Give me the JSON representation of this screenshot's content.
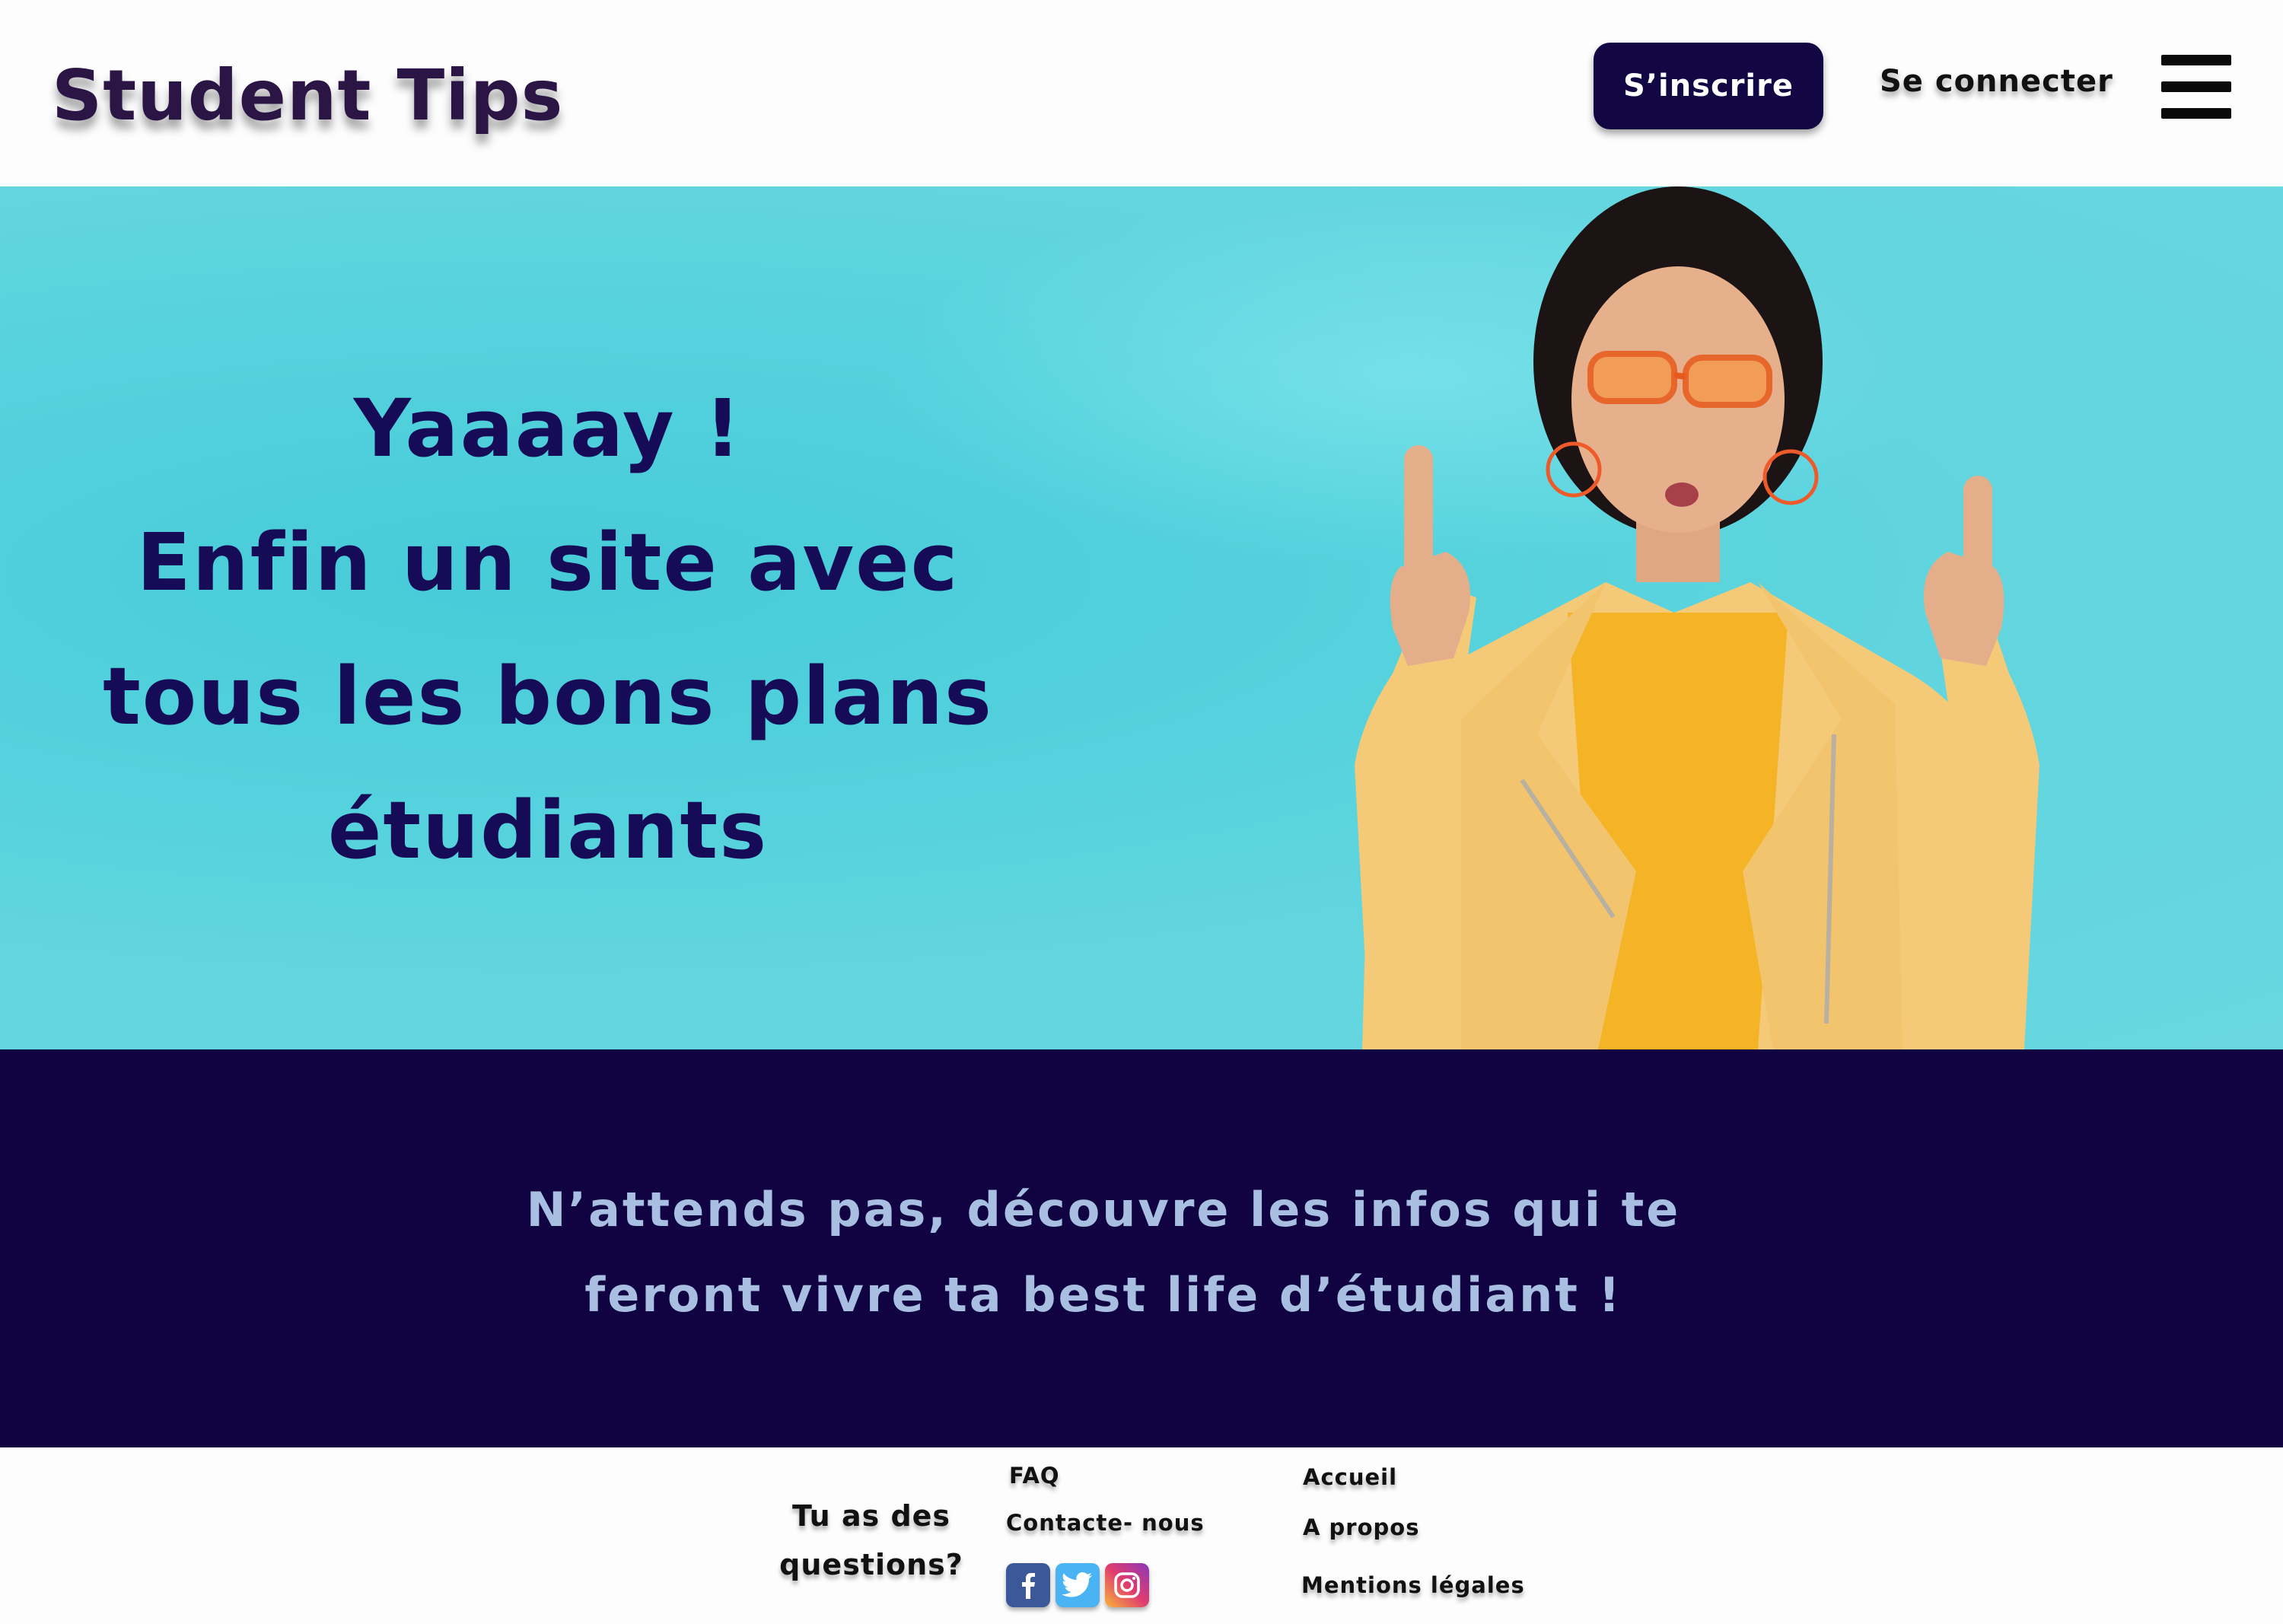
{
  "header": {
    "logo": "Student Tips",
    "signup_label": "S’inscrire",
    "login_label": "Se connecter",
    "menu_icon": "hamburger-menu-icon"
  },
  "hero": {
    "lines": [
      "Yaaaay !",
      "Enfin un site avec",
      "tous les bons plans",
      "étudiants"
    ],
    "image": "woman-pointing-up-photo"
  },
  "banner": {
    "lines": [
      "N’attends pas, découvre les infos qui te",
      "feront vivre ta best life d’étudiant !"
    ]
  },
  "footer": {
    "question_lines": [
      "Tu as des",
      "questions?"
    ],
    "faq": "FAQ",
    "contact": "Contacte- nous",
    "social": [
      "facebook-icon",
      "twitter-icon",
      "instagram-icon"
    ],
    "links": [
      "Accueil",
      "A propos",
      "Mentions légales"
    ]
  },
  "colors": {
    "navy": "#110341",
    "hero_text": "#150b57",
    "banner_text": "#a9bfe2",
    "hero_bg": "#54d2dd"
  }
}
